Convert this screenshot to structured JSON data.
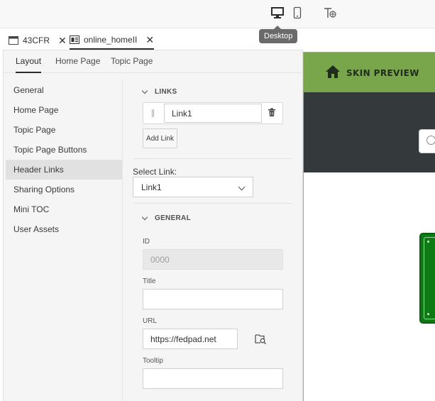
{
  "toolbar": {
    "icons": [
      "desktop-icon",
      "mobile-icon",
      "text-scale-icon"
    ],
    "tooltip": "Desktop"
  },
  "doc_tabs": [
    {
      "label": "43CFR",
      "icon": "window-icon",
      "active": false
    },
    {
      "label": "online_homeII",
      "icon": "skin-icon",
      "active": true
    }
  ],
  "close_glyph": "✕",
  "sub_tabs": [
    "Layout",
    "Home Page",
    "Topic Page"
  ],
  "nav": {
    "items": [
      "General",
      "Home Page",
      "Topic Page",
      "Topic Page Buttons",
      "Header Links",
      "Sharing Options",
      "Mini TOC",
      "User Assets"
    ],
    "active": "Header Links"
  },
  "links": {
    "header": "LINKS",
    "items": [
      {
        "value": "Link1"
      }
    ],
    "add_label": "Add Link"
  },
  "select_link": {
    "label": "Select Link:",
    "value": "Link1"
  },
  "general": {
    "header": "GENERAL",
    "id_label": "ID",
    "id_value": "0000",
    "title_label": "Title",
    "title_value": "",
    "url_label": "URL",
    "url_value": "https://fedpad.net",
    "tooltip_label": "Tooltip",
    "tooltip_value": ""
  },
  "preview": {
    "title": "SKIN PREVIEW",
    "colors": {
      "header": "#7aa64b",
      "body": "#343a3c",
      "accent": "#0e7a14"
    }
  }
}
